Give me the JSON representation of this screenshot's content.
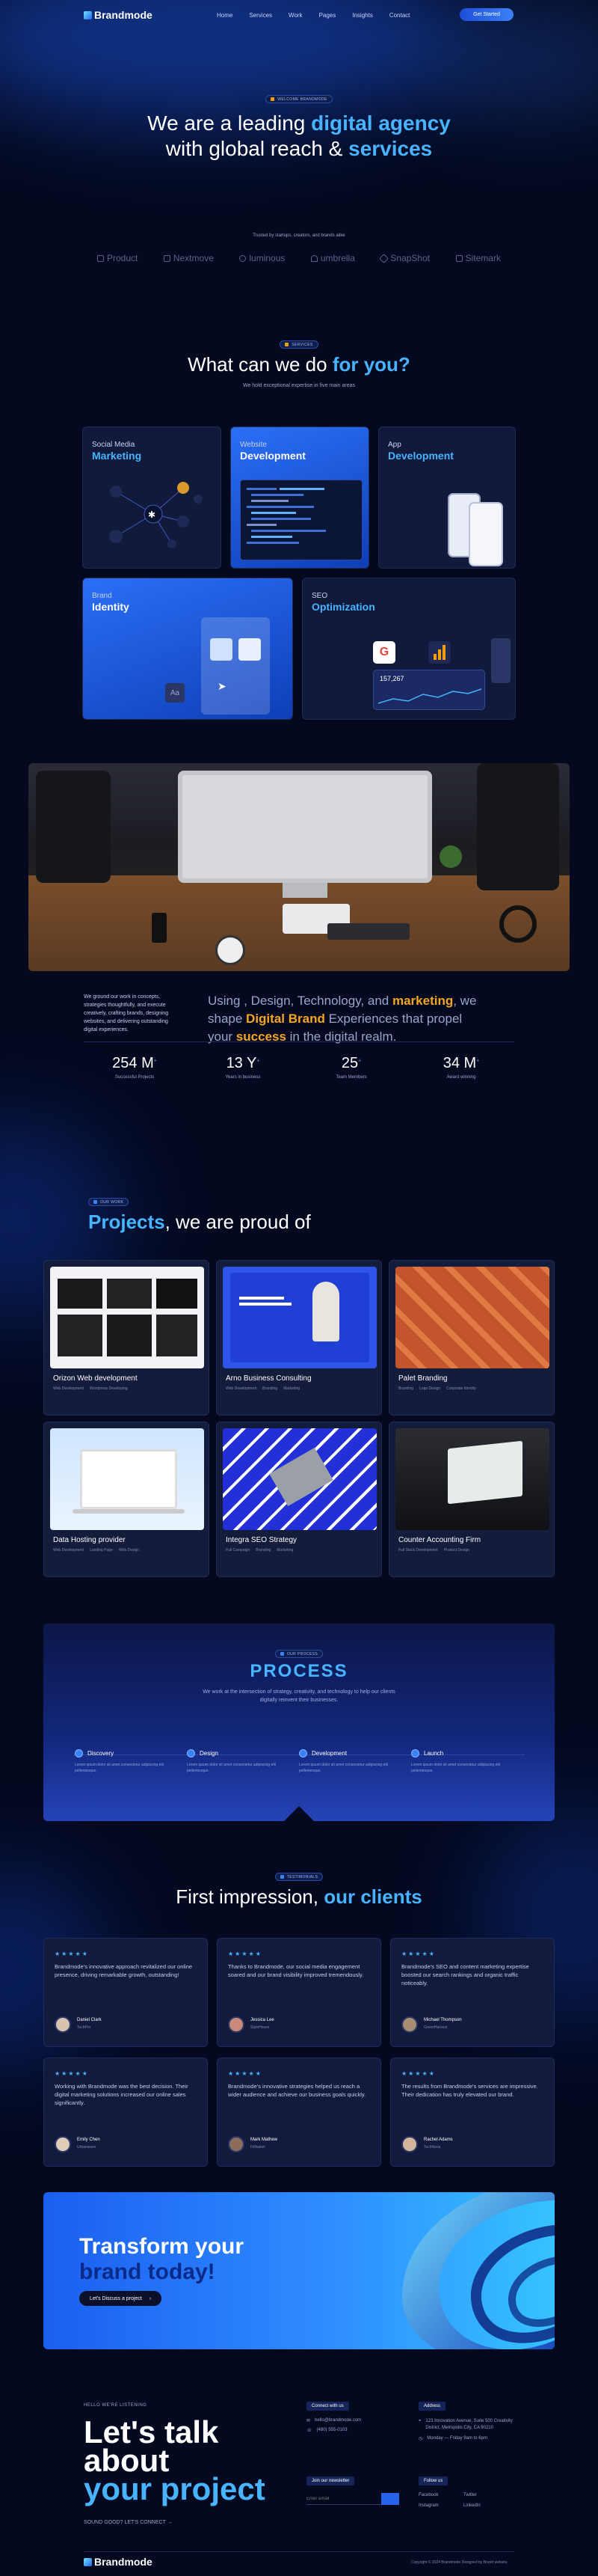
{
  "nav": {
    "logo": "Brandmode",
    "menu": [
      "Home",
      "Services",
      "Work",
      "Pages",
      "Insights",
      "Contact"
    ],
    "cta": "Get Started"
  },
  "hero": {
    "badge": "WELCOME BRANDMODE",
    "line1_a": "We are a leading ",
    "line1_b": "digital agency",
    "line2_a": "with global reach & ",
    "line2_b": "services",
    "trusted": "Trusted by startups, creators, and brands alike",
    "brands": [
      "Product",
      "Nextmove",
      "luminous",
      "umbrella",
      "SnapShot",
      "Sitemark"
    ]
  },
  "services": {
    "badge": "SERVICES",
    "title_a": "What can we do ",
    "title_b": "for you?",
    "subtitle": "We hold exceptional expertise in five main areas",
    "cards": [
      {
        "top": "Social Media",
        "main": "Marketing"
      },
      {
        "top": "Website",
        "main": "Development"
      },
      {
        "top": "App",
        "main": "Development"
      },
      {
        "top": "Brand",
        "main": "Identity"
      },
      {
        "top": "SEO",
        "main": "Optimization"
      }
    ],
    "seo_value": "157,267"
  },
  "about": {
    "intro": "We ground our work in concepts, strategies thoughtfully, and execute creatively, crafting brands, designing websites, and delivering outstanding digital experiences.",
    "s1": "Using , Design, Technology, and ",
    "s1_hl": "marketing",
    "s1_end": ", we",
    "s2": "shape ",
    "s2_hl": "Digital Brand",
    "s2_end": " Experiences that propel",
    "s3": "your ",
    "s3_hl": "success",
    "s3_end": " in the digital realm.",
    "stats": [
      {
        "n": "254 M",
        "t": "Successful Projects"
      },
      {
        "n": "13 Y",
        "t": "Years in business"
      },
      {
        "n": "25",
        "t": "Team Members"
      },
      {
        "n": "34 M",
        "t": "Award winning"
      }
    ]
  },
  "projects": {
    "badge": "OUR WORK",
    "title_a": "Projects",
    "title_b": ", we are proud of",
    "items": [
      {
        "title": "Orizon Web development",
        "tags": [
          "Web Development",
          "Wordpress Developing"
        ]
      },
      {
        "title": "Arno Business Consulting",
        "tags": [
          "Web Development",
          "Branding",
          "Marketing"
        ]
      },
      {
        "title": "Palet Branding",
        "tags": [
          "Branding",
          "Logo Design",
          "Corporate Identity"
        ]
      },
      {
        "title": "Data Hosting provider",
        "tags": [
          "Web Development",
          "Landing Page",
          "Web Design"
        ]
      },
      {
        "title": "Integra SEO Strategy",
        "tags": [
          "Full Campaign",
          "Branding",
          "Marketing"
        ]
      },
      {
        "title": "Counter Accounting Firm",
        "tags": [
          "Full Stack Development",
          "Product Design"
        ]
      }
    ]
  },
  "process": {
    "badge": "OUR PROCESS",
    "title": "PROCESS",
    "desc": "We work at the intersection of strategy, creativity, and technology to help our clients digitally reinvent their businesses.",
    "steps": [
      {
        "name": "Discovery",
        "desc": "Lorem ipsum dolor sit amet consectetur adipiscing elit pellentesque."
      },
      {
        "name": "Design",
        "desc": "Lorem ipsum dolor sit amet consectetur adipiscing elit pellentesque."
      },
      {
        "name": "Development",
        "desc": "Lorem ipsum dolor sit amet consectetur adipiscing elit pellentesque."
      },
      {
        "name": "Launch",
        "desc": "Lorem ipsum dolor sit amet consectetur adipiscing elit pellentesque."
      }
    ]
  },
  "testimonials": {
    "badge": "TESTIMONIALS",
    "title_a": "First impression, ",
    "title_b": "our clients",
    "stars": "★★★★★",
    "items": [
      {
        "q": "Brandmode's innovative approach revitalized our online presence, driving remarkable growth, outstanding!",
        "name": "Daniel Clark",
        "role": "TechPro"
      },
      {
        "q": "Thanks to Brandmode, our social media engagement soared and our brand visibility improved tremendously.",
        "name": "Jessica Lee",
        "role": "StyleHouse"
      },
      {
        "q": "Brandmode's SEO and content marketing expertise boosted our search rankings and organic traffic noticeably.",
        "name": "Michael Thompson",
        "role": "GreenHarvest"
      },
      {
        "q": "Working with Brandmode was the best decision. Their digital marketing solutions increased our online sales significantly.",
        "name": "Emily Chen",
        "role": "Urbanwave"
      },
      {
        "q": "Brandmode's innovative strategies helped us reach a wider audience and achieve our business goals quickly.",
        "name": "Mark Mathew",
        "role": "FitNation"
      },
      {
        "q": "The results from Brandmode's services are impressive. Their dedication has truly elevated our brand.",
        "name": "Rachel Adams",
        "role": "TechNova"
      }
    ]
  },
  "cta": {
    "line1": "Transform your",
    "line2": "brand today!",
    "button": "Let's Discuss a project"
  },
  "footer": {
    "hello": "HELLO WE'RE LISTENING",
    "h1": "Let's talk",
    "h2": "about",
    "h3": "your project",
    "sub": "SOUND GOOD? LET'S CONNECT →",
    "contact_hd": "Connect with us",
    "email": "hello@brandmode.com",
    "phone": "(480) 555-0103",
    "address_hd": "Address",
    "address": "123 Innovation Avenue, Suite 500 Creativity District, Metropolis City, CA 90210",
    "hours": "Monday — Friday 9am to 6pm",
    "newsletter_hd": "Join our newsletter",
    "newsletter_ph": "Enter email",
    "follow_hd": "Follow us",
    "socials": [
      "Facebook",
      "Twitter",
      "Instagram",
      "LinkedIn"
    ],
    "logo": "Brandmode",
    "copyright": "Copyright © 2024 Brandmode Designed by Brand website"
  },
  "colors": {
    "accent": "#48b4ff",
    "bg": "#040920",
    "blue": "#2563eb"
  }
}
